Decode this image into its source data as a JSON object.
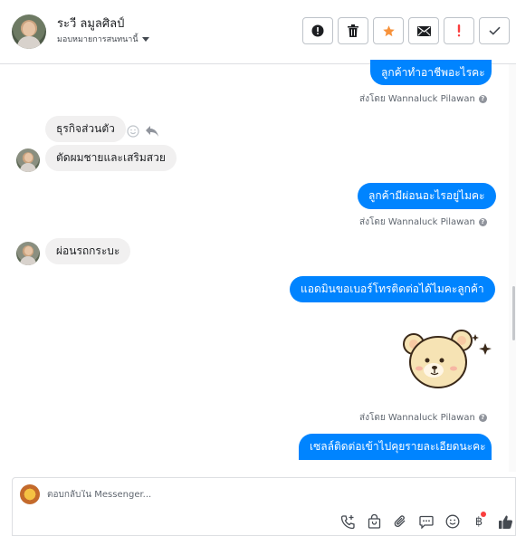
{
  "header": {
    "contact_name": "ระวี ลมูลศิลป์",
    "assign_label": "มอบหมายการสนทนานี้",
    "actions": [
      {
        "name": "report-button",
        "icon": "alert-circle-icon"
      },
      {
        "name": "delete-button",
        "icon": "trash-icon"
      },
      {
        "name": "star-button",
        "icon": "star-icon"
      },
      {
        "name": "mark-unread-button",
        "icon": "envelope-icon"
      },
      {
        "name": "flag-button",
        "icon": "exclamation-icon"
      },
      {
        "name": "done-button",
        "icon": "check-icon"
      }
    ]
  },
  "messages": {
    "m1": "ลูกค้าทำอาชีพอะไรคะ",
    "m1_sent_by": "ส่งโดย Wannaluck Pilawan",
    "m2": "ธุรกิจส่วนตัว",
    "m3": "ตัดผมชายและเสริมสวย",
    "m4": "ลูกค้ามีผ่อนอะไรอยู่ไมคะ",
    "m4_sent_by": "ส่งโดย Wannaluck Pilawan",
    "m5": "ผ่อนรถกระบะ",
    "m6": "แอดมินขอเบอร์โทรติดต่อได้ไมคะลูกค้า",
    "m7_sent_by": "ส่งโดย Wannaluck Pilawan",
    "m8": "เซลล์ติดต่อเข้าไปคุยรายละเอียดนะคะ"
  },
  "composer": {
    "placeholder": "ตอบกลับใน Messenger...",
    "baht_symbol": "฿"
  },
  "colors": {
    "outgoing": "#0084ff",
    "incoming": "#f1f0f0",
    "star": "#f7923b",
    "alert": "#fa3e3e"
  }
}
